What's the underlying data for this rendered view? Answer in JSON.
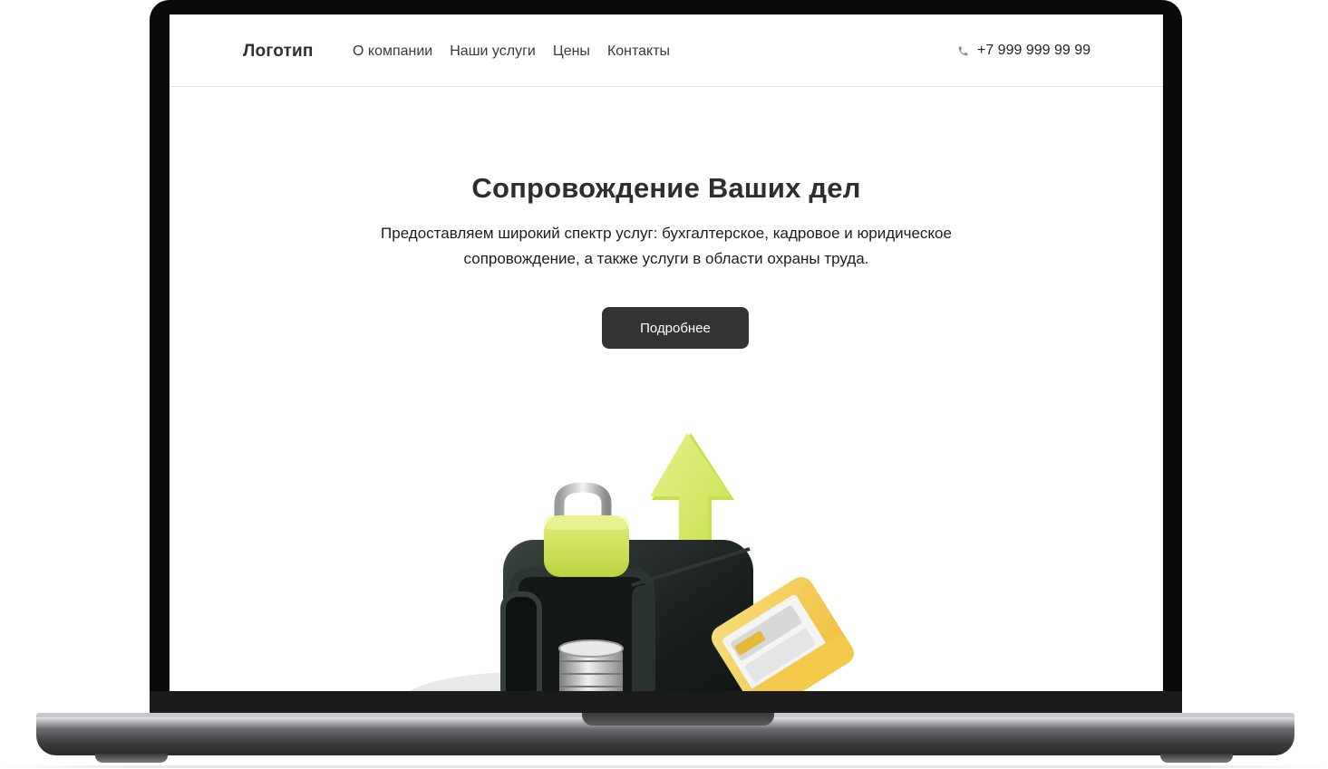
{
  "header": {
    "logo": "Логотип",
    "nav": [
      "О компании",
      "Наши услуги",
      "Цены",
      "Контакты"
    ],
    "phone": "+7 999 999 99 99",
    "phone_icon": "phone-icon"
  },
  "hero": {
    "title": "Сопровождение Ваших дел",
    "description": "Предоставляем широкий спектр услуг: бухгалтерское, кадровое и юридическое сопровождение, а также услуги в области охраны труда.",
    "button_label": "Подробнее"
  },
  "colors": {
    "accent_green": "#d6e86a",
    "button_dark": "#333331",
    "text_dark": "#2e2e2e",
    "folder_yellow": "#f3c94d"
  }
}
